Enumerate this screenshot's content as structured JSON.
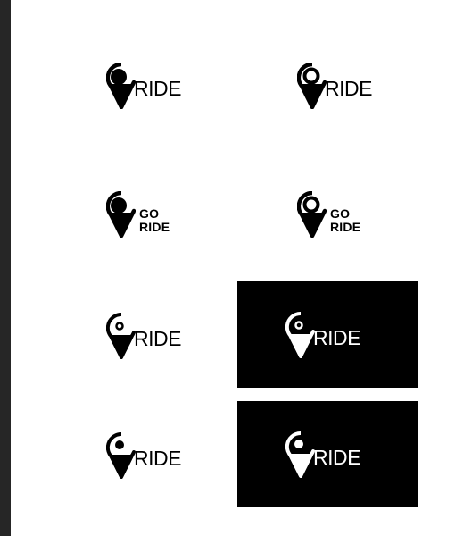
{
  "logos": {
    "r1c1": {
      "word": "RIDE",
      "pin": "solid-dot-pin-icon"
    },
    "r1c2": {
      "word": "RIDE",
      "pin": "ring-pin-icon"
    },
    "r2c1": {
      "line1": "GO",
      "line2": "RIDE",
      "pin": "solid-dot-pin-icon"
    },
    "r2c2": {
      "line1": "GO",
      "line2": "RIDE",
      "pin": "ring-pin-icon"
    },
    "r3c1": {
      "word": "RIDE",
      "pin": "outline-pin-icon"
    },
    "r3c2": {
      "word": "RIDE",
      "pin": "outline-pin-icon"
    },
    "r4c1": {
      "word": "RIDE",
      "pin": "outline-dot-pin-icon"
    },
    "r4c2": {
      "word": "RIDE",
      "pin": "outline-dot-pin-icon"
    }
  },
  "colors": {
    "ink": "#000000",
    "paper": "#ffffff",
    "frame": "#2b2b2b"
  }
}
